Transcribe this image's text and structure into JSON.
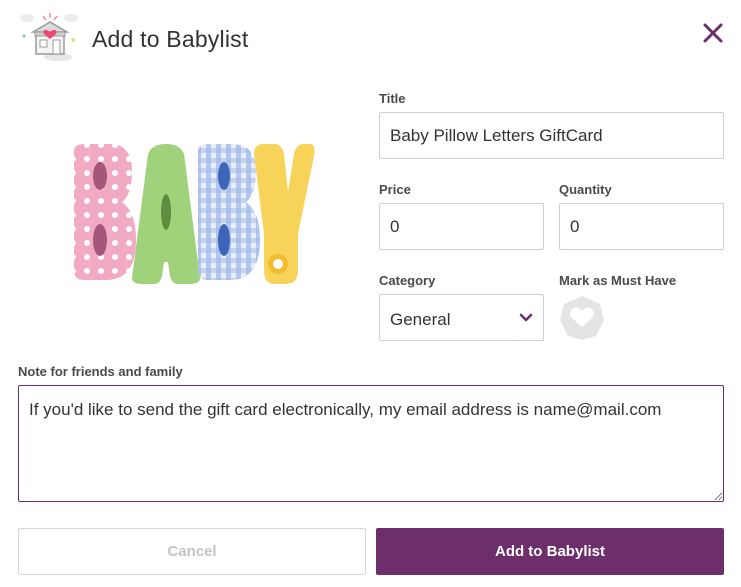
{
  "modal": {
    "title": "Add to Babylist"
  },
  "product": {
    "image_alt": "BABY"
  },
  "form": {
    "title_label": "Title",
    "title_value": "Baby Pillow Letters GiftCard",
    "price_label": "Price",
    "price_value": "0",
    "quantity_label": "Quantity",
    "quantity_value": "0",
    "category_label": "Category",
    "category_value": "General",
    "must_have_label": "Mark as Must Have",
    "note_label": "Note for friends and family",
    "note_value": "If you'd like to send the gift card electronically, my email address is name@mail.com"
  },
  "actions": {
    "cancel_label": "Cancel",
    "add_label": "Add to Babylist"
  },
  "icons": {
    "logo": "babylist-store-logo",
    "close": "close-icon",
    "chevron": "chevron-down-icon",
    "must_have": "heart-icon"
  },
  "colors": {
    "brand": "#6d2f6b",
    "border": "#cfcfcf",
    "text": "#333333",
    "cancel_text": "#c4c4c4"
  }
}
